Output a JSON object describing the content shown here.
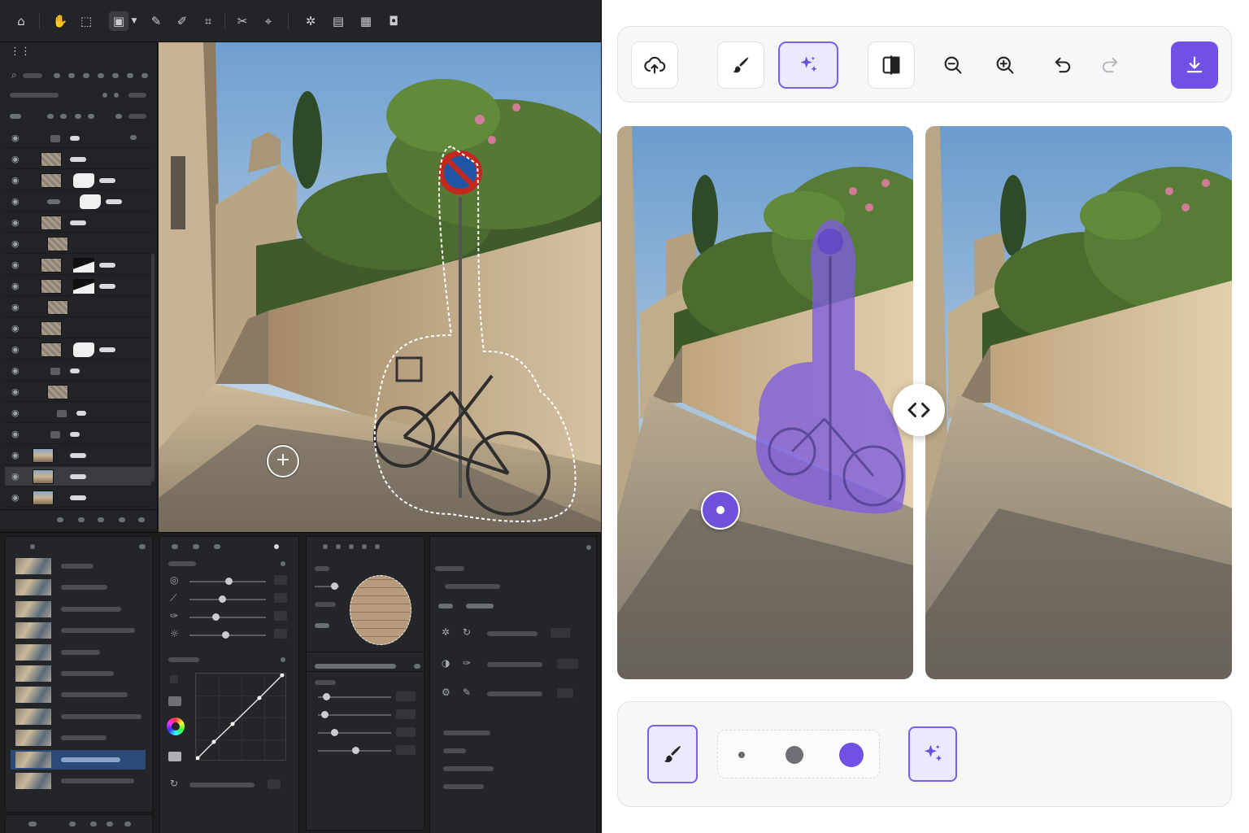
{
  "editor": {
    "toolbar_icons": [
      "home-icon",
      "hand-icon",
      "marquee-icon",
      "selection-icon",
      "chevron-down-icon",
      "eraser-icon",
      "pen-icon",
      "ruler-icon",
      "clone-icon",
      "target-icon",
      "transform-icon",
      "layers-icon",
      "grid-icon",
      "camera-icon"
    ],
    "layers_panel": {
      "rows": [
        {
          "kind": "group",
          "mask": "none"
        },
        {
          "kind": "texture",
          "mask": "none"
        },
        {
          "kind": "texture",
          "mask": "white"
        },
        {
          "kind": "link",
          "mask": "white"
        },
        {
          "kind": "texture",
          "mask": "none"
        },
        {
          "kind": "texture",
          "mask": "none"
        },
        {
          "kind": "texture",
          "mask": "split"
        },
        {
          "kind": "texture",
          "mask": "split"
        },
        {
          "kind": "texture",
          "mask": "none"
        },
        {
          "kind": "texture",
          "mask": "none"
        },
        {
          "kind": "texture",
          "mask": "white"
        },
        {
          "kind": "group",
          "mask": "none"
        },
        {
          "kind": "texture",
          "mask": "none"
        },
        {
          "kind": "group",
          "mask": "none"
        },
        {
          "kind": "group",
          "mask": "none"
        },
        {
          "kind": "image",
          "mask": "none"
        },
        {
          "kind": "image",
          "mask": "none",
          "selected": true
        },
        {
          "kind": "image",
          "mask": "none"
        }
      ]
    },
    "filmstrip_count": 11,
    "filmstrip_selected_index": 9
  },
  "app": {
    "accent": "#7150e5",
    "accent_light": "#ece8fd",
    "toolbar": {
      "upload": "upload-icon",
      "brush": "brush-icon",
      "magic": "sparkles-icon",
      "compare": "compare-icon",
      "zoom_out": "zoom-out-icon",
      "zoom_in": "zoom-in-icon",
      "undo": "undo-icon",
      "redo": "redo-icon",
      "download": "download-icon",
      "active_tool": "magic"
    },
    "compare_handle_icon": "chevrons-left-right-icon",
    "brush_sizes": [
      "small",
      "medium",
      "large"
    ],
    "selected_brush_size": "large"
  }
}
